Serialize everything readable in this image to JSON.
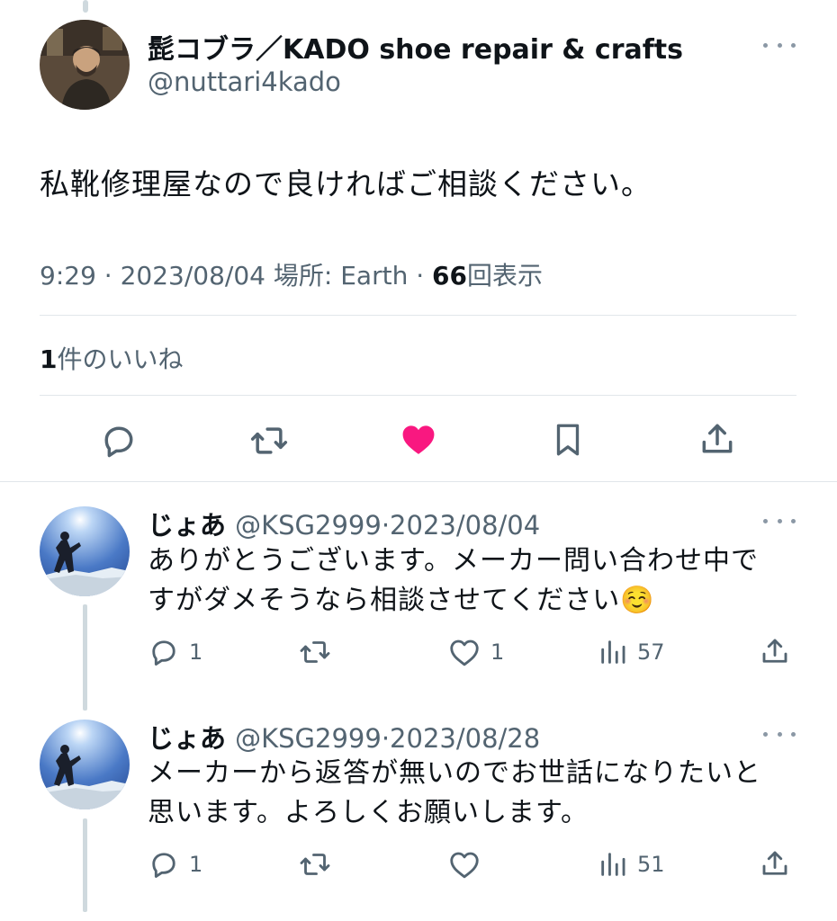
{
  "main_tweet": {
    "display_name": "髭コブラ／KADO shoe repair & crafts",
    "handle": "@nuttari4kado",
    "text": "私靴修理屋なので良ければご相談ください。",
    "time": "9:29",
    "date": "2023/08/04",
    "location_label": "場所: Earth",
    "views_count": "66",
    "views_label": "回表示",
    "likes_count": "1",
    "likes_label": "件のいいね",
    "liked": true,
    "like_color": "#f91880"
  },
  "replies": [
    {
      "name": "じょあ",
      "handle": "@KSG2999",
      "date": "2023/08/04",
      "text": "ありがとうございます。メーカー問い合わせ中ですがダメそうなら相談させてください☺️",
      "reply_count": "1",
      "like_count": "1",
      "views": "57"
    },
    {
      "name": "じょあ",
      "handle": "@KSG2999",
      "date": "2023/08/28",
      "text": "メーカーから返答が無いのでお世話になりたいと思います。よろしくお願いします。",
      "reply_count": "1",
      "like_count": "",
      "views": "51"
    }
  ],
  "separator": "·",
  "colors": {
    "text": "#0f1419",
    "secondary": "#536471",
    "border": "#e1e6ea",
    "like": "#f91880"
  }
}
